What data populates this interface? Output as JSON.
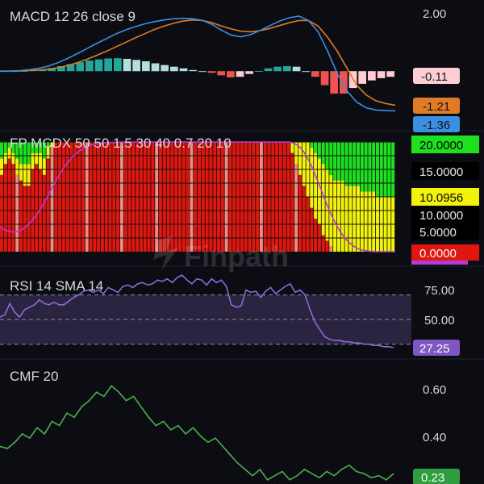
{
  "watermark": "Finpath",
  "colors": {
    "background": "#0b0d12",
    "separator": "#1f232c",
    "macd_line": "#3a8fe0",
    "signal_line": "#e07b25",
    "hist_pos_strong": "#26a69a",
    "hist_pos_weak": "#b2dfdb",
    "hist_neg_strong": "#ef5350",
    "hist_neg_weak": "#ffcdd2",
    "fp_red": "#e0170f",
    "fp_yellow": "#f2f20a",
    "fp_green": "#1fe01f",
    "fp_pink": "#f28b82",
    "fp_purple_line": "#b23bd6",
    "rsi_line": "#8a6ad8",
    "rsi_band": "#2a2440",
    "cmf_line": "#4caf50"
  },
  "chart_data": [
    {
      "type": "line",
      "title": "MACD 12 26 close 9",
      "ylim": [
        -2.0,
        2.3
      ],
      "tick_labels": [
        "2.00"
      ],
      "series": [
        {
          "role": "macd",
          "values": [
            0.0,
            0.0,
            0.02,
            0.05,
            0.1,
            0.18,
            0.3,
            0.45,
            0.62,
            0.8,
            0.98,
            1.15,
            1.32,
            1.46,
            1.58,
            1.68,
            1.76,
            1.82,
            1.86,
            1.88,
            1.86,
            1.8,
            1.66,
            1.45,
            1.28,
            1.22,
            1.3,
            1.45,
            1.62,
            1.78,
            1.9,
            1.96,
            1.8,
            1.4,
            0.7,
            -0.1,
            -0.7,
            -1.1,
            -1.3,
            -1.38,
            -1.4,
            -1.41
          ]
        },
        {
          "role": "signal",
          "values": [
            0.0,
            0.0,
            0.01,
            0.02,
            0.04,
            0.07,
            0.12,
            0.2,
            0.3,
            0.42,
            0.56,
            0.7,
            0.86,
            1.02,
            1.18,
            1.33,
            1.48,
            1.6,
            1.7,
            1.78,
            1.82,
            1.8,
            1.72,
            1.6,
            1.5,
            1.42,
            1.4,
            1.44,
            1.52,
            1.62,
            1.72,
            1.8,
            1.8,
            1.6,
            1.2,
            0.7,
            0.1,
            -0.5,
            -0.85,
            -1.05,
            -1.15,
            -1.21
          ]
        },
        {
          "role": "histogram",
          "type": "bar",
          "values": [
            0.0,
            0.0,
            0.01,
            0.03,
            0.06,
            0.11,
            0.18,
            0.25,
            0.32,
            0.38,
            0.42,
            0.45,
            0.46,
            0.44,
            0.4,
            0.35,
            0.28,
            0.22,
            0.16,
            0.1,
            0.04,
            0.0,
            -0.06,
            -0.15,
            -0.22,
            -0.2,
            -0.1,
            0.01,
            0.1,
            0.16,
            0.18,
            0.16,
            0.0,
            -0.2,
            -0.5,
            -0.8,
            -0.8,
            -0.6,
            -0.45,
            -0.33,
            -0.25,
            -0.2
          ]
        }
      ],
      "value_badges": [
        {
          "label": "-0.11",
          "kind": "histogram"
        },
        {
          "label": "-1.21",
          "kind": "signal"
        },
        {
          "label": "-1.36",
          "kind": "macd"
        }
      ]
    },
    {
      "type": "bar",
      "title": "FP MCDX 50 50 1.5 30 40 0.7 20 10",
      "ylim": [
        0,
        20
      ],
      "tick_labels": [
        "20.0000",
        "15.0000",
        "10.0956",
        "10.0000",
        "5.0000",
        "0.0000"
      ],
      "bars": {
        "red": [
          14,
          16,
          17,
          16,
          14,
          13,
          12,
          12,
          15,
          16,
          15,
          14,
          17,
          19,
          20,
          20,
          20,
          20,
          20,
          20,
          20,
          20,
          20,
          20,
          20,
          20,
          20,
          20,
          20,
          20,
          20,
          20,
          20,
          20,
          20,
          20,
          20,
          20,
          20,
          20,
          20,
          20,
          20,
          20,
          20,
          20,
          20,
          20,
          20,
          20,
          20,
          20,
          20,
          20,
          20,
          20,
          20,
          20,
          20,
          20,
          20,
          20,
          20,
          20,
          20,
          20,
          20,
          20,
          20,
          20,
          20,
          20,
          20,
          20,
          20,
          18,
          16,
          14,
          12,
          10,
          8,
          6,
          5,
          3,
          2,
          1,
          0,
          0,
          0,
          0,
          0,
          0,
          0,
          0,
          0,
          0,
          0,
          0,
          0,
          0,
          0,
          0
        ],
        "yellow": [
          3,
          2,
          2,
          2,
          3,
          3,
          4,
          4,
          3,
          2,
          3,
          3,
          2,
          1,
          0,
          0,
          0,
          0,
          0,
          0,
          0,
          0,
          0,
          0,
          0,
          0,
          0,
          0,
          0,
          0,
          0,
          0,
          0,
          0,
          0,
          0,
          0,
          0,
          0,
          0,
          0,
          0,
          0,
          0,
          0,
          0,
          0,
          0,
          0,
          0,
          0,
          0,
          0,
          0,
          0,
          0,
          0,
          0,
          0,
          0,
          0,
          0,
          0,
          0,
          0,
          0,
          0,
          0,
          0,
          0,
          0,
          0,
          0,
          0,
          0,
          2,
          4,
          6,
          8,
          10,
          11,
          12,
          12,
          13,
          13,
          13,
          13,
          13,
          13,
          12,
          12,
          12,
          12,
          11,
          11,
          11,
          11,
          10,
          10,
          10,
          10,
          10
        ],
        "green": [
          3,
          2,
          1,
          2,
          3,
          4,
          4,
          4,
          2,
          2,
          2,
          3,
          1,
          0,
          0,
          0,
          0,
          0,
          0,
          0,
          0,
          0,
          0,
          0,
          0,
          0,
          0,
          0,
          0,
          0,
          0,
          0,
          0,
          0,
          0,
          0,
          0,
          0,
          0,
          0,
          0,
          0,
          0,
          0,
          0,
          0,
          0,
          0,
          0,
          0,
          0,
          0,
          0,
          0,
          0,
          0,
          0,
          0,
          0,
          0,
          0,
          0,
          0,
          0,
          0,
          0,
          0,
          0,
          0,
          0,
          0,
          0,
          0,
          0,
          0,
          0,
          0,
          0,
          0,
          0,
          1,
          2,
          3,
          4,
          5,
          6,
          7,
          7,
          7,
          8,
          8,
          8,
          8,
          9,
          9,
          9,
          9,
          10,
          10,
          10,
          10,
          10
        ]
      },
      "line": [
        4.5,
        4.0,
        3.8,
        3.6,
        3.6,
        3.8,
        4.2,
        4.8,
        5.5,
        6.4,
        7.4,
        8.6,
        9.8,
        11.2,
        12.5,
        13.8,
        15.0,
        16.0,
        16.9,
        17.6,
        18.2,
        18.7,
        19.1,
        19.4,
        19.6,
        19.7,
        19.8,
        19.85,
        19.9,
        19.9,
        19.95,
        20,
        20,
        20,
        20,
        20,
        20,
        20,
        20,
        20,
        20,
        20,
        20,
        20,
        20,
        20,
        20,
        20,
        20,
        20,
        20,
        20,
        20,
        20,
        20,
        20,
        20,
        20,
        20,
        20,
        20,
        20,
        20,
        20,
        20,
        20,
        20,
        20,
        20,
        20,
        20,
        20,
        20,
        20,
        20,
        19.8,
        19.4,
        18.8,
        17.8,
        16.5,
        15.0,
        13.2,
        11.4,
        9.5,
        7.8,
        6.2,
        4.8,
        3.6,
        2.6,
        1.8,
        1.2,
        0.7,
        0.4,
        0.2,
        0.1,
        0.05,
        0,
        0,
        0,
        0,
        0,
        0
      ]
    },
    {
      "type": "line",
      "title": "RSI 14 SMA 14",
      "ylim": [
        20,
        90
      ],
      "tick_labels": [
        "75.00",
        "50.00"
      ],
      "value_badge": "27.25",
      "band": [
        30,
        70
      ],
      "values": [
        52,
        54,
        63,
        56,
        52,
        58,
        60,
        62,
        66,
        63,
        62,
        64,
        62,
        62,
        65,
        68,
        70,
        73,
        74,
        72,
        74,
        71,
        76,
        74,
        72,
        77,
        78,
        76,
        79,
        80,
        78,
        79,
        82,
        81,
        83,
        80,
        84,
        86,
        82,
        79,
        83,
        82,
        78,
        83,
        80,
        82,
        77,
        62,
        60,
        61,
        74,
        72,
        73,
        68,
        73,
        76,
        71,
        74,
        77,
        79,
        72,
        74,
        70,
        58,
        48,
        42,
        36,
        34,
        33,
        33,
        32,
        32,
        31,
        31,
        30,
        30,
        29,
        29,
        28,
        28,
        27.25
      ]
    },
    {
      "type": "line",
      "title": "CMF 20",
      "ylim": [
        0.18,
        0.76
      ],
      "tick_labels": [
        "0.60",
        "0.40"
      ],
      "value_badge": "0.23",
      "values": [
        0.36,
        0.35,
        0.38,
        0.42,
        0.4,
        0.45,
        0.42,
        0.48,
        0.46,
        0.52,
        0.5,
        0.55,
        0.58,
        0.62,
        0.6,
        0.65,
        0.62,
        0.58,
        0.6,
        0.55,
        0.5,
        0.46,
        0.48,
        0.44,
        0.46,
        0.42,
        0.45,
        0.41,
        0.38,
        0.4,
        0.36,
        0.32,
        0.28,
        0.25,
        0.22,
        0.25,
        0.2,
        0.22,
        0.24,
        0.2,
        0.22,
        0.25,
        0.23,
        0.21,
        0.24,
        0.22,
        0.25,
        0.27,
        0.24,
        0.23,
        0.21,
        0.22,
        0.2,
        0.23
      ]
    }
  ]
}
